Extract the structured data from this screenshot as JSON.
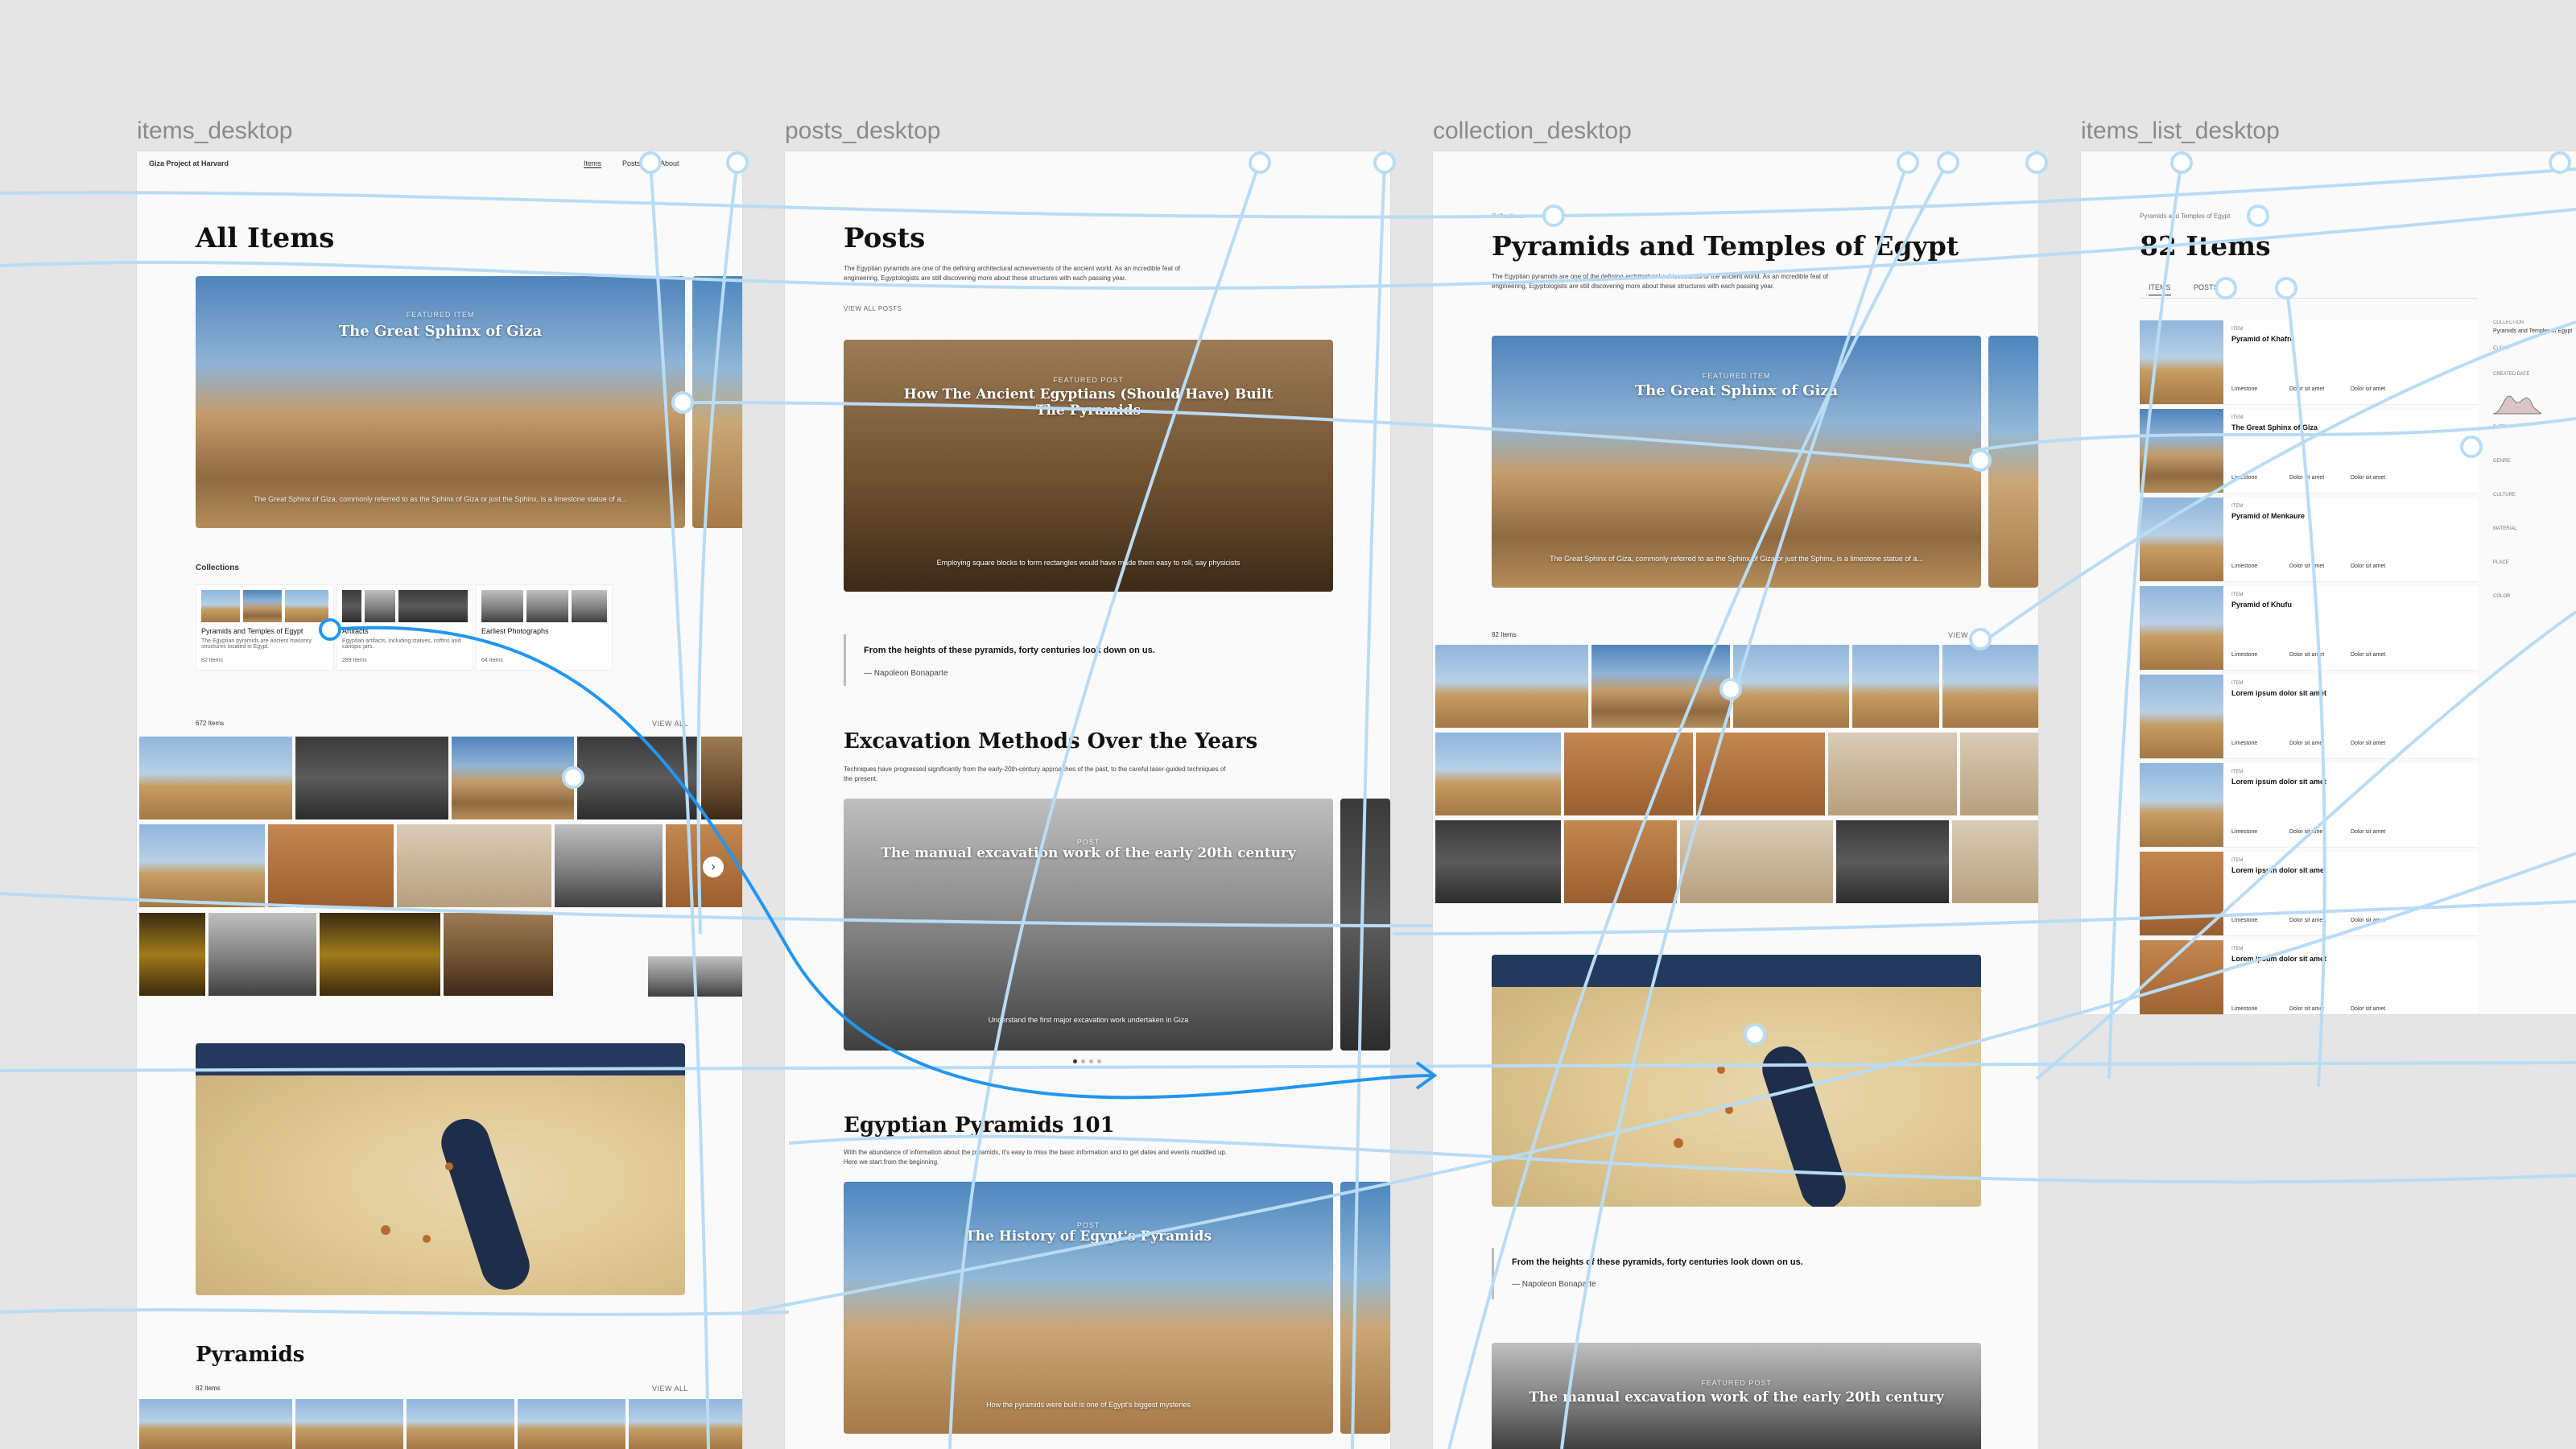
{
  "frames": {
    "items": {
      "label": "items_desktop",
      "nav": {
        "brand": "Giza Project at Harvard",
        "items": [
          "Items",
          "Posts",
          "About"
        ]
      },
      "title": "All Items",
      "hero": {
        "kicker": "FEATURED ITEM",
        "title": "The Great Sphinx of Giza",
        "caption": "The Great Sphinx of Giza, commonly referred to as the Sphinx of Giza or just the Sphinx, is a limestone statue of a..."
      },
      "collections_label": "Collections",
      "collections": [
        {
          "name": "Pyramids and Temples of Egypt",
          "desc": "The Egyptian pyramids are ancient masonry structures located in Egypt.",
          "count": "82 Items"
        },
        {
          "name": "Artifacts",
          "desc": "Egyptian artifacts, including statues, coffins and canopic jars.",
          "count": "289 Items"
        },
        {
          "name": "Earliest Photographs",
          "desc": "",
          "count": "64 Items"
        }
      ],
      "items_count": "672 Items",
      "view_all": "VIEW ALL",
      "section": "Pyramids",
      "section_count": "82 Items",
      "section_view_all": "VIEW ALL"
    },
    "posts": {
      "label": "posts_desktop",
      "title": "Posts",
      "intro": "The Egyptian pyramids are one of the defining architectural achievements of the ancient world. As an incredible feat of engineering, Egyptologists are still discovering more about these structures with each passing year.",
      "view_all": "VIEW ALL POSTS",
      "hero": {
        "kicker": "FEATURED POST",
        "title": "How The Ancient Egyptians (Should Have) Built The Pyramids",
        "caption": "Employing square blocks to form rectangles would have made them easy to roll, say physicists"
      },
      "quote": "From the heights of these pyramids, forty centuries look down on us.",
      "quote_author": "— Napoleon Bonaparte",
      "section1": {
        "title": "Excavation Methods Over the Years",
        "desc": "Techniques have progressed significantly from the early-20th-century approaches of the past, to the careful laser-guided techniques of the present.",
        "card_kicker": "POST",
        "card_title": "The manual excavation work of the early 20th century",
        "card_caption": "Understand the first major excavation work undertaken in Giza"
      },
      "section2": {
        "title": "Egyptian Pyramids 101",
        "desc": "With the abundance of information about the pyramids, it's easy to miss the basic information and to get dates and events muddled up. Here we start from the beginning.",
        "card_kicker": "POST",
        "card_title": "The History of Egypt's Pyramids",
        "card_caption": "How the pyramids were built is one of Egypt's biggest mysteries"
      }
    },
    "collection": {
      "label": "collection_desktop",
      "breadcrumb": "Collections",
      "title": "Pyramids and Temples of Egypt",
      "intro": "The Egyptian pyramids are one of the defining architectural achievements of the ancient world. As an incredible feat of engineering, Egyptologists are still discovering more about these structures with each passing year.",
      "hero": {
        "kicker": "FEATURED ITEM",
        "title": "The Great Sphinx of Giza",
        "caption": "The Great Sphinx of Giza, commonly referred to as the Sphinx of Giza or just the Sphinx, is a limestone statue of a..."
      },
      "items_count": "82 Items",
      "view_all": "VIEW",
      "quote": "From the heights of these pyramids, forty centuries look down on us.",
      "quote_author": "— Napoleon Bonaparte",
      "post_kicker": "FEATURED POST",
      "post_title": "The manual excavation work of the early 20th century"
    },
    "list": {
      "label": "items_list_desktop",
      "breadcrumb": "Pyramids and Temples of Egypt",
      "title": "82 Items",
      "tabs": [
        "ITEMS",
        "POSTS"
      ],
      "rows": [
        {
          "kicker": "ITEM",
          "title": "Pyramid of Khafre",
          "m1": "Limestone",
          "m2": "Dolor sit amet",
          "m3": "Dolor sit amet"
        },
        {
          "kicker": "ITEM",
          "title": "The Great Sphinx of Giza",
          "m1": "Limestone",
          "m2": "Dolor sit amet",
          "m3": "Dolor sit amet"
        },
        {
          "kicker": "ITEM",
          "title": "Pyramid of Menkaure",
          "m1": "Limestone",
          "m2": "Dolor sit amet",
          "m3": "Dolor sit amet"
        },
        {
          "kicker": "ITEM",
          "title": "Pyramid of Khufu",
          "m1": "Limestone",
          "m2": "Dolor sit amet",
          "m3": "Dolor sit amet"
        },
        {
          "kicker": "ITEM",
          "title": "Lorem ipsum dolor sit amet",
          "m1": "Limestone",
          "m2": "Dolor sit amet",
          "m3": "Dolor sit amet"
        },
        {
          "kicker": "ITEM",
          "title": "Lorem ipsum dolor sit amet",
          "m1": "Limestone",
          "m2": "Dolor sit amet",
          "m3": "Dolor sit amet"
        },
        {
          "kicker": "ITEM",
          "title": "Lorem ipsum dolor sit amet",
          "m1": "Limestone",
          "m2": "Dolor sit amet",
          "m3": "Dolor sit amet"
        },
        {
          "kicker": "ITEM",
          "title": "Lorem ipsum dolor sit amet",
          "m1": "Limestone",
          "m2": "Dolor sit amet",
          "m3": "Dolor sit amet"
        }
      ],
      "filters": {
        "collection_label": "COLLECTION",
        "collection_value": "Pyramids and Temples of Egypt",
        "clear": "CLEAR",
        "date_label": "CREATED DATE",
        "filters": [
          "DATE",
          "GENRE",
          "CULTURE",
          "MATERIAL",
          "PLACE",
          "COLOR"
        ]
      }
    }
  },
  "colors": {
    "canvas": "#e5e5e5",
    "wire": "#b9dcf5",
    "wire_active": "#2196f3",
    "frame": "#fafafa"
  }
}
